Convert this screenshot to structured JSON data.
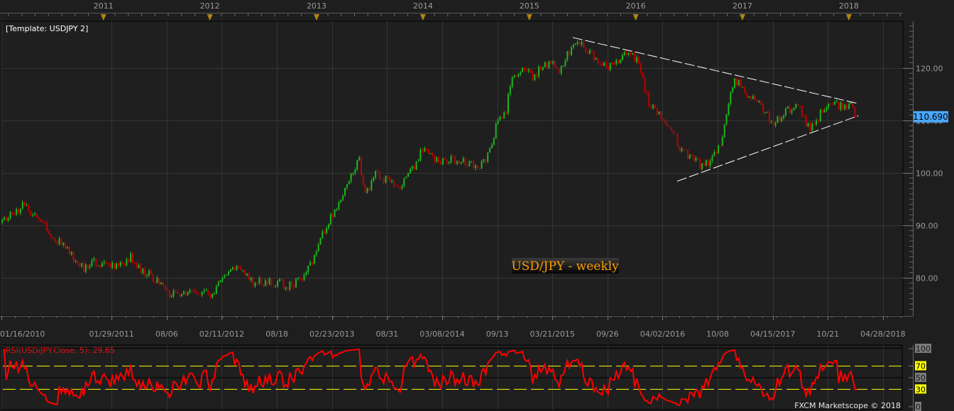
{
  "chart_data": {
    "type": "candlestick",
    "template_label": "[Template: USDJPY 2]",
    "title": "USD/JPY - weekly",
    "instrument": "USD/JPY",
    "timeframe": "weekly",
    "ylim": [
      72.7,
      128.9
    ],
    "y_ticks": [
      "120.00",
      "110.00",
      "100.00",
      "90.00",
      "80.00"
    ],
    "y_tick_values": [
      120,
      110,
      100,
      90,
      80
    ],
    "year_labels": [
      "2011",
      "2012",
      "2013",
      "2014",
      "2015",
      "2016",
      "2017",
      "2018"
    ],
    "x_labels": [
      "01/16/2010",
      "01/29/2011",
      "08/06",
      "02/11/2012",
      "08/18",
      "02/23/2013",
      "08/31",
      "03/08/2014",
      "09/13",
      "03/21/2015",
      "09/26",
      "04/02/2016",
      "10/08",
      "04/15/2017",
      "10/21",
      "04/28/2018"
    ],
    "x_label_dates": [
      "2010-01-16",
      "2011-01-29",
      "2011-08-06",
      "2012-02-11",
      "2012-08-18",
      "2013-02-23",
      "2013-08-31",
      "2014-03-08",
      "2014-09-13",
      "2015-03-21",
      "2015-09-26",
      "2016-04-02",
      "2016-10-08",
      "2017-04-15",
      "2017-10-21",
      "2018-04-28"
    ],
    "last_price": "110.690",
    "close_keypoints": [
      [
        "2010-01-16",
        90.5
      ],
      [
        "2010-03-27",
        93.8
      ],
      [
        "2010-06-05",
        91.0
      ],
      [
        "2010-07-10",
        87.7
      ],
      [
        "2010-09-04",
        85.0
      ],
      [
        "2010-10-23",
        81.6
      ],
      [
        "2010-11-20",
        83.2
      ],
      [
        "2011-01-08",
        82.7
      ],
      [
        "2011-03-05",
        82.3
      ],
      [
        "2011-04-02",
        84.3
      ],
      [
        "2011-05-07",
        81.0
      ],
      [
        "2011-06-11",
        80.5
      ],
      [
        "2011-07-30",
        77.3
      ],
      [
        "2011-09-24",
        76.5
      ],
      [
        "2011-11-12",
        77.3
      ],
      [
        "2012-01-07",
        76.5
      ],
      [
        "2012-03-10",
        82.3
      ],
      [
        "2012-04-07",
        81.6
      ],
      [
        "2012-05-26",
        79.2
      ],
      [
        "2012-08-11",
        79.0
      ],
      [
        "2012-10-06",
        78.5
      ],
      [
        "2012-11-10",
        79.6
      ],
      [
        "2012-12-15",
        83.6
      ],
      [
        "2013-01-19",
        88.4
      ],
      [
        "2013-03-09",
        93.8
      ],
      [
        "2013-04-20",
        99.2
      ],
      [
        "2013-05-25",
        102.6
      ],
      [
        "2013-06-15",
        95.8
      ],
      [
        "2013-07-20",
        99.5
      ],
      [
        "2013-09-07",
        98.5
      ],
      [
        "2013-10-12",
        97.6
      ],
      [
        "2013-11-30",
        101.2
      ],
      [
        "2013-12-28",
        104.6
      ],
      [
        "2014-02-08",
        102.2
      ],
      [
        "2014-04-05",
        102.6
      ],
      [
        "2014-05-24",
        101.9
      ],
      [
        "2014-07-12",
        101.6
      ],
      [
        "2014-08-16",
        103.9
      ],
      [
        "2014-09-06",
        108.9
      ],
      [
        "2014-10-11",
        111.4
      ],
      [
        "2014-10-25",
        116.8
      ],
      [
        "2014-12-06",
        120.1
      ],
      [
        "2015-01-10",
        118.4
      ],
      [
        "2015-02-28",
        120.8
      ],
      [
        "2015-04-18",
        119.7
      ],
      [
        "2015-05-30",
        124.9
      ],
      [
        "2015-07-18",
        123.5
      ],
      [
        "2015-09-05",
        120.1
      ],
      [
        "2015-10-24",
        120.8
      ],
      [
        "2015-11-28",
        123.2
      ],
      [
        "2016-01-02",
        121.5
      ],
      [
        "2016-01-23",
        118.1
      ],
      [
        "2016-02-13",
        112.7
      ],
      [
        "2016-04-02",
        110.7
      ],
      [
        "2016-05-07",
        108.0
      ],
      [
        "2016-05-28",
        104.6
      ],
      [
        "2016-07-02",
        103.2
      ],
      [
        "2016-08-13",
        101.2
      ],
      [
        "2016-09-17",
        102.6
      ],
      [
        "2016-10-22",
        106.0
      ],
      [
        "2016-11-12",
        114.0
      ],
      [
        "2016-12-03",
        118.1
      ],
      [
        "2017-01-07",
        115.4
      ],
      [
        "2017-02-11",
        114.0
      ],
      [
        "2017-04-15",
        109.3
      ],
      [
        "2017-05-20",
        111.4
      ],
      [
        "2017-07-08",
        113.4
      ],
      [
        "2017-08-12",
        108.6
      ],
      [
        "2017-09-16",
        110.7
      ],
      [
        "2017-10-21",
        114.0
      ],
      [
        "2017-12-02",
        112.7
      ],
      [
        "2018-01-06",
        113.0
      ],
      [
        "2018-01-27",
        110.69
      ]
    ],
    "trendlines": [
      {
        "from": [
          "2015-05-30",
          125.8
        ],
        "to": [
          "2018-02-03",
          113.2
        ],
        "style": "dashed",
        "color": "#ffffff"
      },
      {
        "from": [
          "2016-05-22",
          98.4
        ],
        "to": [
          "2018-02-03",
          110.9
        ],
        "style": "dashed",
        "color": "#ffffff"
      }
    ],
    "colors": {
      "up": "#1fb51f",
      "down": "#c00000",
      "background": "#1f1f1f",
      "grid": "#353535",
      "last_price_tag": "#4aa8ff",
      "year_marker": "#b8860b",
      "title_text": "#ff9a00"
    },
    "indicator": {
      "label": "RSI(USD/JPY.Close, 5): 29.65",
      "name": "RSI",
      "period": 5,
      "last_value": 29.65,
      "ylim": [
        0,
        100
      ],
      "y_ticks": [
        "100",
        "70",
        "50",
        "30",
        "0"
      ],
      "levels": [
        70,
        50,
        30
      ],
      "line_color": "#ff0000",
      "level_color": "#ffff00"
    }
  },
  "footer": {
    "brand": "FXCM Marketscope © 2018"
  }
}
